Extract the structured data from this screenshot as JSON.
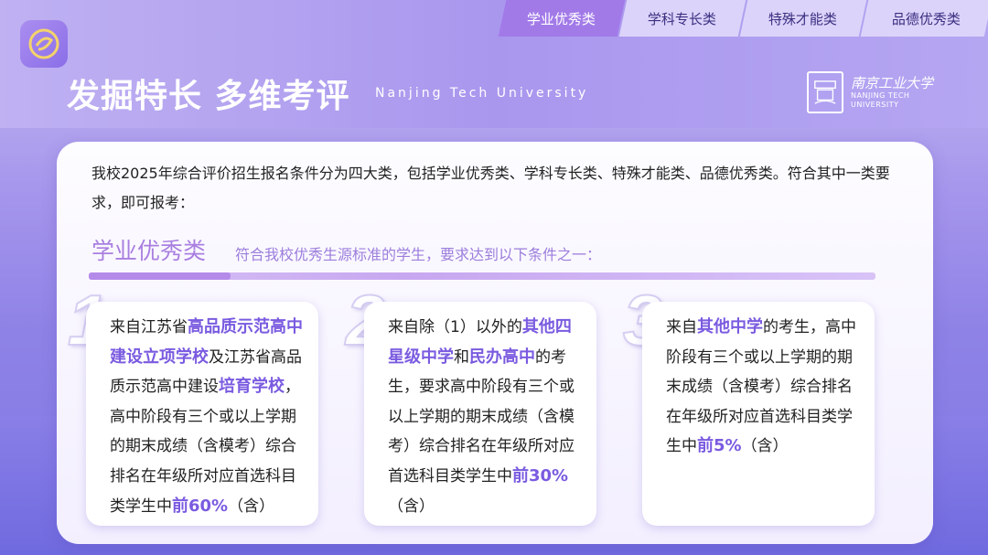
{
  "tabs": [
    {
      "label": "学业优秀类",
      "active": true
    },
    {
      "label": "学科专长类",
      "active": false
    },
    {
      "label": "特殊才能类",
      "active": false
    },
    {
      "label": "品德优秀类",
      "active": false
    }
  ],
  "header": {
    "title": "发掘特长 多维考评",
    "subtitle": "Nanjing Tech University",
    "university_cn": "南京工业大学",
    "university_en_1": "NANJING TECH",
    "university_en_2": "UNIVERSITY"
  },
  "intro": "我校2025年综合评价招生报名条件分为四大类，包括学业优秀类、学科专长类、特殊才能类、品德优秀类。符合其中一类要求，即可报考：",
  "category": {
    "title": "学业优秀类",
    "desc": "符合我校优秀生源标准的学生，要求达到以下条件之一："
  },
  "items": [
    {
      "num": "1",
      "t1": "来自江苏省",
      "h1": "高品质示范高中建设立项学校",
      "t2": "及江苏省高品质示范高中建设",
      "h2": "培育学校",
      "t3": "，高中阶段有三个或以上学期的期末成绩（含模考）综合排名在年级所对应首选科目类学生中",
      "h3": "前60%",
      "t4": "（含）"
    },
    {
      "num": "2",
      "t1": "来自除（1）以外的",
      "h1": "其他四星级中学",
      "t2": "和",
      "h2": "民办高中",
      "t3": "的考生，要求高中阶段有三个或以上学期的期末成绩（含模考）综合排名在年级所对应首选科目类学生中",
      "h3": "前30%",
      "t4": "（含）"
    },
    {
      "num": "3",
      "t1": "来自",
      "h1": "其他中学",
      "t2": "的考生，高中阶段有三个或以上学期的期末成绩（含模考）综合排名在年级所对应首选科目类学生中",
      "h3": "前5%",
      "t4": "（含）"
    }
  ],
  "colors": {
    "accent": "#7a5be0",
    "tab_active": "#a27ae8",
    "category": "#a97fe0"
  }
}
